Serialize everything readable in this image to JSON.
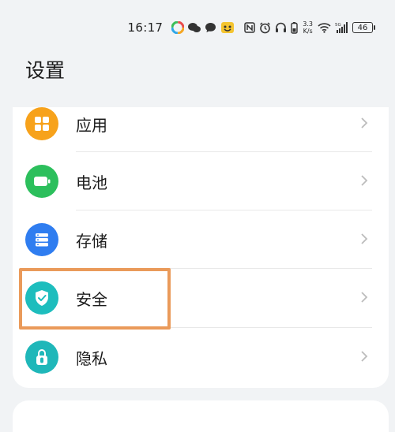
{
  "status_bar": {
    "time": "16:17",
    "net_speed_value": "3.3",
    "net_speed_unit": "K/s",
    "battery": "46",
    "icons": [
      "multicolor-app-icon",
      "wechat-icon",
      "message-icon",
      "emoji-app-icon",
      "nfc-icon",
      "alarm-icon",
      "headphones-icon",
      "phone-battery-icon",
      "wifi-icon",
      "signal-5g-icon"
    ]
  },
  "page": {
    "title": "设置"
  },
  "settings": {
    "items": [
      {
        "label": "应用",
        "icon": "apps-grid-icon",
        "color": "#f7a21b"
      },
      {
        "label": "电池",
        "icon": "battery-icon",
        "color": "#2cbf5c"
      },
      {
        "label": "存储",
        "icon": "storage-icon",
        "color": "#2f7df0"
      },
      {
        "label": "安全",
        "icon": "shield-check-icon",
        "color": "#1dbdbd"
      },
      {
        "label": "隐私",
        "icon": "privacy-lock-icon",
        "color": "#1fb7b9"
      }
    ]
  },
  "colors": {
    "highlight": "#ea9a5a",
    "background": "#f1f3f5",
    "card": "#ffffff"
  }
}
